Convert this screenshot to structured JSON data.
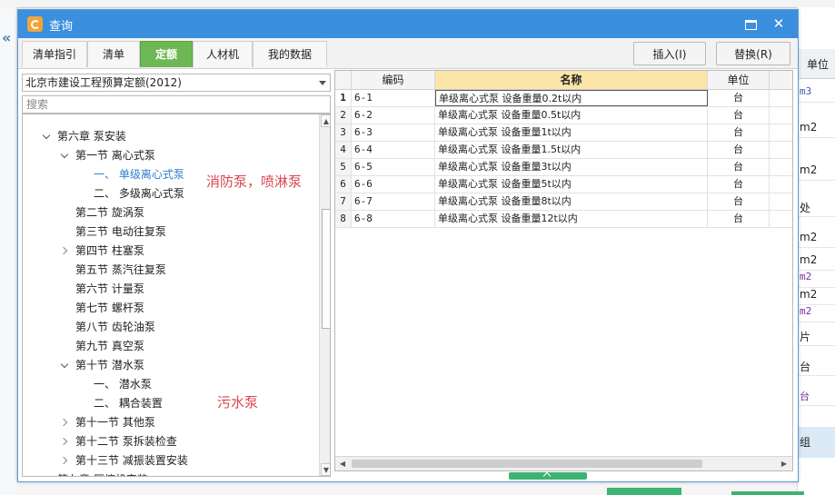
{
  "background": {
    "right_header": "单位",
    "right_cells": [
      "m3",
      "m2",
      "m2",
      "处",
      "m2",
      "m2",
      "m2",
      "m2",
      "m2",
      "片",
      "台",
      "台",
      "组"
    ]
  },
  "dialog": {
    "title": "查询",
    "maximize_label": "",
    "close_label": "✕",
    "tabs": [
      {
        "label": "清单指引",
        "active": false
      },
      {
        "label": "清单",
        "active": false
      },
      {
        "label": "定额",
        "active": true
      },
      {
        "label": "人材机",
        "active": false
      },
      {
        "label": "我的数据",
        "active": false
      }
    ],
    "insert_label": "插入(I)",
    "replace_label": "替换(R)"
  },
  "library": {
    "selected": "北京市建设工程预算定额(2012)"
  },
  "search": {
    "placeholder": "搜索",
    "value": ""
  },
  "tree": [
    {
      "label": "第六章 泵安装",
      "level": 1,
      "expand": "down"
    },
    {
      "label": "第一节 离心式泵",
      "level": 2,
      "expand": "down"
    },
    {
      "label": "一、 单级离心式泵",
      "level": 3,
      "expand": "none",
      "selected": true
    },
    {
      "label": "二、 多级离心式泵",
      "level": 3,
      "expand": "none"
    },
    {
      "label": "第二节 旋涡泵",
      "level": 2,
      "expand": "none"
    },
    {
      "label": "第三节 电动往复泵",
      "level": 2,
      "expand": "none"
    },
    {
      "label": "第四节 柱塞泵",
      "level": 2,
      "expand": "right"
    },
    {
      "label": "第五节 蒸汽往复泵",
      "level": 2,
      "expand": "none"
    },
    {
      "label": "第六节 计量泵",
      "level": 2,
      "expand": "none"
    },
    {
      "label": "第七节 螺杆泵",
      "level": 2,
      "expand": "none"
    },
    {
      "label": "第八节 齿轮油泵",
      "level": 2,
      "expand": "none"
    },
    {
      "label": "第九节 真空泵",
      "level": 2,
      "expand": "none"
    },
    {
      "label": "第十节 潜水泵",
      "level": 2,
      "expand": "down"
    },
    {
      "label": "一、 潜水泵",
      "level": 3,
      "expand": "none"
    },
    {
      "label": "二、 耦合装置",
      "level": 3,
      "expand": "none"
    },
    {
      "label": "第十一节 其他泵",
      "level": 2,
      "expand": "right"
    },
    {
      "label": "第十二节 泵拆装检查",
      "level": 2,
      "expand": "right"
    },
    {
      "label": "第十三节 减振装置安装",
      "level": 2,
      "expand": "right"
    },
    {
      "label": "第七章 压缩机安装",
      "level": 1,
      "expand": "right"
    }
  ],
  "annotations": {
    "note1": "消防泵，喷淋泵",
    "note2": "污水泵"
  },
  "grid": {
    "headers": {
      "code": "编码",
      "name": "名称",
      "unit": "单位"
    },
    "rows": [
      {
        "no": "1",
        "code": "6-1",
        "name": "单级离心式泵 设备重量0.2t以内",
        "unit": "台"
      },
      {
        "no": "2",
        "code": "6-2",
        "name": "单级离心式泵 设备重量0.5t以内",
        "unit": "台"
      },
      {
        "no": "3",
        "code": "6-3",
        "name": "单级离心式泵 设备重量1t以内",
        "unit": "台"
      },
      {
        "no": "4",
        "code": "6-4",
        "name": "单级离心式泵 设备重量1.5t以内",
        "unit": "台"
      },
      {
        "no": "5",
        "code": "6-5",
        "name": "单级离心式泵 设备重量3t以内",
        "unit": "台"
      },
      {
        "no": "6",
        "code": "6-6",
        "name": "单级离心式泵 设备重量5t以内",
        "unit": "台"
      },
      {
        "no": "7",
        "code": "6-7",
        "name": "单级离心式泵 设备重量8t以内",
        "unit": "台"
      },
      {
        "no": "8",
        "code": "6-8",
        "name": "单级离心式泵 设备重量12t以内",
        "unit": "台"
      }
    ]
  },
  "colors": {
    "titlebar": "#3a8fde",
    "active_tab": "#6db854",
    "annotation": "#d9464f",
    "header_highlight": "#fbe6a8"
  }
}
